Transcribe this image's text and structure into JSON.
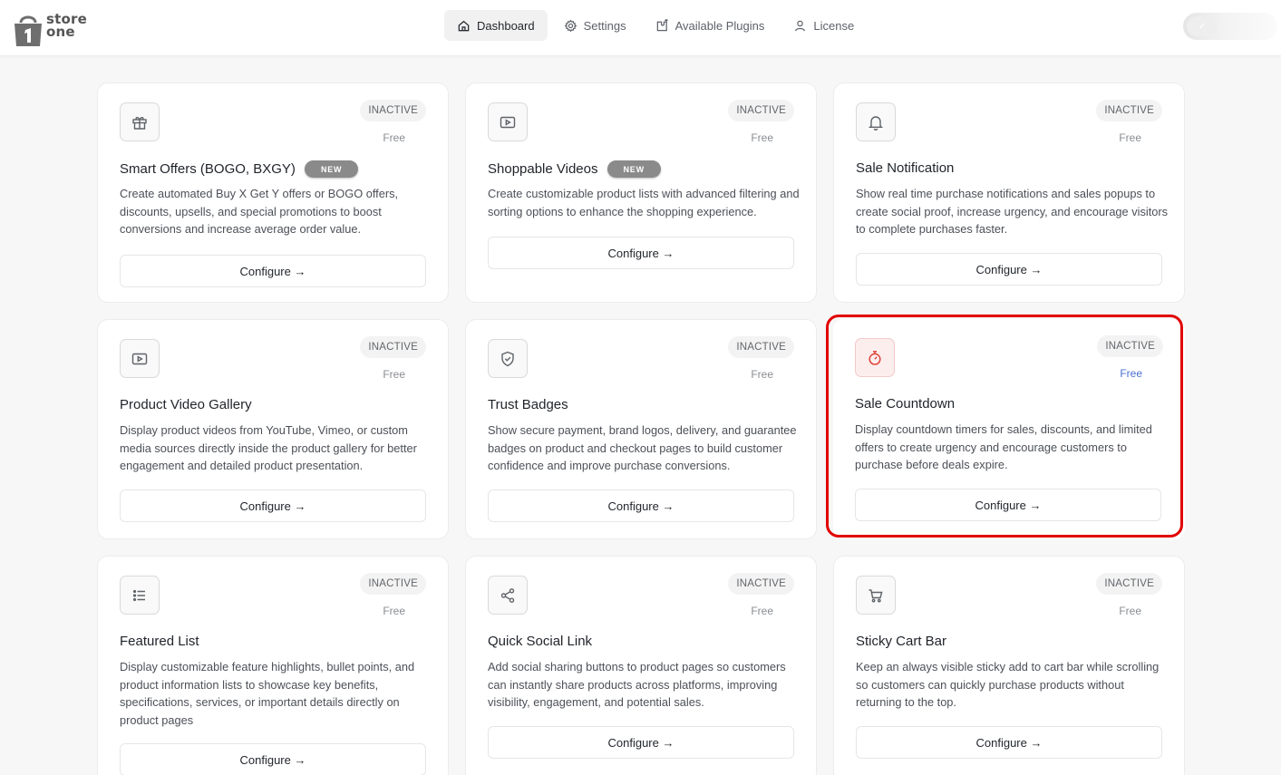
{
  "app": {
    "logo_line1": "store",
    "logo_line2": "one"
  },
  "nav": [
    {
      "label": "Dashboard",
      "icon": "home-icon",
      "active": true
    },
    {
      "label": "Settings",
      "icon": "gear-icon",
      "active": false
    },
    {
      "label": "Available Plugins",
      "icon": "plugin-icon",
      "active": false
    },
    {
      "label": "License",
      "icon": "user-icon",
      "active": false
    }
  ],
  "configure_label": "Configure →",
  "cards": [
    {
      "title": "Smart Offers (BOGO, BXGY)",
      "badge": "NEW",
      "status": "INACTIVE",
      "price": "Free",
      "icon": "gift-icon",
      "desc": "Create automated Buy X Get Y offers or BOGO offers, discounts, upsells, and special promotions to boost conversions and increase average order value."
    },
    {
      "title": "Shoppable Videos",
      "badge": "NEW",
      "status": "INACTIVE",
      "price": "Free",
      "icon": "video-play-icon",
      "desc": "Create customizable product lists with advanced filtering and sorting options to enhance the shopping experience."
    },
    {
      "title": "Sale Notification",
      "status": "INACTIVE",
      "price": "Free",
      "icon": "bell-icon",
      "desc": "Show real time purchase notifications and sales popups to create social proof, increase urgency, and encourage visitors to complete purchases faster."
    },
    {
      "title": "Product Video Gallery",
      "status": "INACTIVE",
      "price": "Free",
      "icon": "video-icon",
      "desc": "Display product videos from YouTube, Vimeo, or custom media sources directly inside the product gallery for better engagement and detailed product presentation."
    },
    {
      "title": "Trust Badges",
      "status": "INACTIVE",
      "price": "Free",
      "icon": "shield-check-icon",
      "desc": "Show secure payment, brand logos, delivery, and guarantee badges on product and checkout pages to build customer confidence and improve purchase conversions."
    },
    {
      "title": "Sale Countdown",
      "status": "INACTIVE",
      "price": "Free",
      "icon": "stopwatch-icon",
      "desc": "Display countdown timers for sales, discounts, and limited offers to create urgency and encourage customers to purchase before deals expire."
    },
    {
      "title": "Featured List",
      "status": "INACTIVE",
      "price": "Free",
      "icon": "list-icon",
      "desc": "Display customizable feature highlights, bullet points, and product information lists to showcase key benefits, specifications, services, or important details directly on product pages"
    },
    {
      "title": "Quick Social Link",
      "status": "INACTIVE",
      "price": "Free",
      "icon": "share-icon",
      "desc": "Add social sharing buttons to product pages so customers can instantly share products across platforms, improving visibility, engagement, and potential sales."
    },
    {
      "title": "Sticky Cart Bar",
      "status": "INACTIVE",
      "price": "Free",
      "icon": "cart-icon",
      "desc": "Keep an always visible sticky add to cart bar while scrolling so customers can quickly purchase products without returning to the top."
    }
  ],
  "colors": {
    "highlight": "#e10000",
    "accent_red": "#e0443a",
    "free_blue": "#4a6fd1"
  }
}
